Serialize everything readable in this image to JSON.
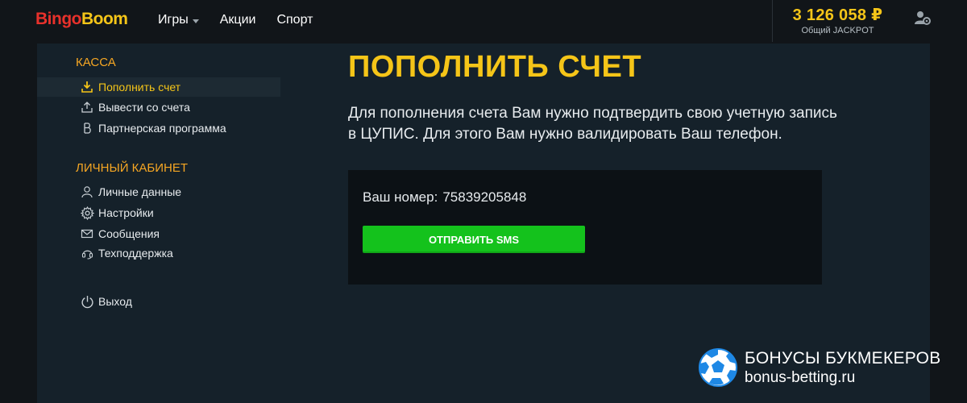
{
  "header": {
    "logo": {
      "part1": "Bingo",
      "part2": "Boom"
    },
    "nav": [
      {
        "label": "Игры",
        "has_dropdown": true
      },
      {
        "label": "Акции",
        "has_dropdown": false
      },
      {
        "label": "Спорт",
        "has_dropdown": false
      }
    ],
    "jackpot": {
      "amount": "3 126 058 ₽",
      "label": "Общий JACKPOT"
    },
    "user_icon": "user-settings-icon"
  },
  "sidebar": {
    "sections": [
      {
        "title": "КАССА",
        "items": [
          {
            "label": "Пополнить счет",
            "icon": "download-icon",
            "active": true
          },
          {
            "label": "Вывести со счета",
            "icon": "upload-icon",
            "active": false
          },
          {
            "label": "Партнерская программа",
            "icon": "bitcoin-icon",
            "active": false
          }
        ]
      },
      {
        "title": "ЛИЧНЫЙ КАБИНЕТ",
        "items": [
          {
            "label": "Личные данные",
            "icon": "user-icon",
            "active": false
          },
          {
            "label": "Настройки",
            "icon": "gear-icon",
            "active": false
          },
          {
            "label": "Сообщения",
            "icon": "envelope-icon",
            "active": false
          },
          {
            "label": "Техподдержка",
            "icon": "support-icon",
            "active": false
          }
        ]
      }
    ],
    "logout": {
      "label": "Выход",
      "icon": "power-icon"
    }
  },
  "main": {
    "title": "ПОПОЛНИТЬ СЧЕТ",
    "info_line1": "Для пополнения счета Вам нужно подтвердить свою учетную запись",
    "info_line2": "в ЦУПИС. Для этого Вам нужно валидировать Ваш телефон.",
    "phone_label": "Ваш номер:",
    "phone_number": "75839205848",
    "sms_button": "ОТПРАВИТЬ SMS"
  },
  "watermark": {
    "line1": "БОНУСЫ БУКМЕКЕРОВ",
    "line2": "bonus-betting.ru",
    "icon": "soccer-ball-icon"
  },
  "colors": {
    "accent_yellow": "#f5c518",
    "section_orange": "#f5a623",
    "logo_red": "#e8312b",
    "button_green": "#14c21c",
    "panel_bg": "#15212a",
    "page_bg": "#111519",
    "box_bg": "#0c1115"
  }
}
